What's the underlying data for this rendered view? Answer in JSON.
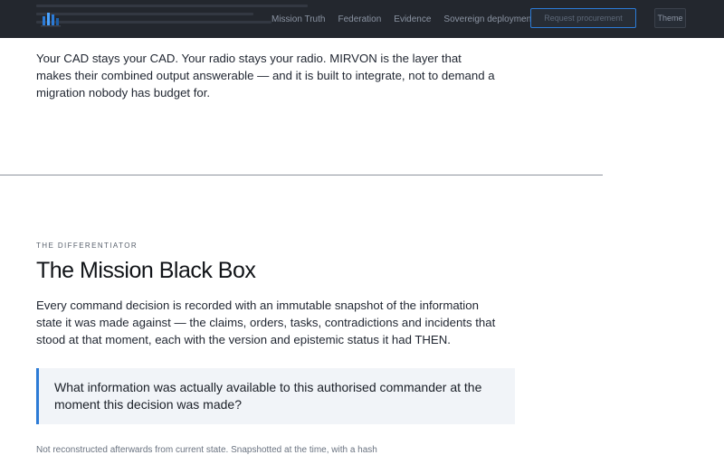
{
  "nav": {
    "links": [
      "Mission Truth",
      "Federation",
      "Evidence",
      "Sovereign deployment"
    ],
    "cta_label": "Request procurement",
    "theme_label": "Theme"
  },
  "intro": {
    "text": "Your CAD stays your CAD. Your radio stays your radio. MIRVON is the layer that makes their combined output answerable — and it is built to integrate, not to demand a migration nobody has budget for."
  },
  "differentiator": {
    "eyebrow": "THE DIFFERENTIATOR",
    "title": "The Mission Black Box",
    "body": "Every command decision is recorded with an immutable snapshot of the information state it was made against — the claims, orders, tasks, contradictions and incidents that stood at that moment, each with the version and epistemic status it had THEN.",
    "callout": "What information was actually available to this authorised commander at the moment this decision was made?",
    "footer": "Not reconstructed afterwards from current state. Snapshotted at the time, with a hash"
  },
  "colors": {
    "nav_bg": "#23272e",
    "accent": "#2c7bd6",
    "callout_bg": "#f1f4f8"
  }
}
